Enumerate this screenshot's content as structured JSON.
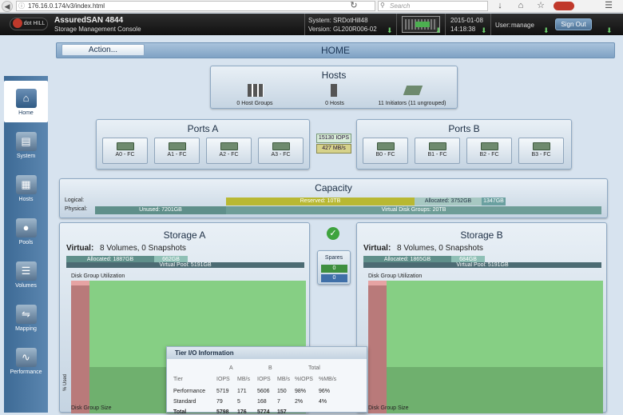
{
  "browser": {
    "url": "176.16.0.174/v3/index.html",
    "search_placeholder": "Search"
  },
  "header": {
    "product": "AssuredSAN 4844",
    "console": "Storage Management Console",
    "logo_text": "dot HILL",
    "system_label": "System:",
    "system_name": "SRDotHill48",
    "version_label": "Version:",
    "version": "GL200R006-02",
    "date": "2015-01-08",
    "time": "14:18:38",
    "user_label": "User:",
    "user": "manage",
    "sign_out": "Sign Out"
  },
  "sidebar": {
    "items": [
      {
        "label": "Home",
        "icon": "home-icon",
        "active": true
      },
      {
        "label": "System",
        "icon": "system-icon"
      },
      {
        "label": "Hosts",
        "icon": "hosts-icon"
      },
      {
        "label": "Pools",
        "icon": "pools-icon"
      },
      {
        "label": "Volumes",
        "icon": "volumes-icon"
      },
      {
        "label": "Mapping",
        "icon": "mapping-icon"
      },
      {
        "label": "Performance",
        "icon": "performance-icon"
      }
    ]
  },
  "toolbar": {
    "action_label": "Action...",
    "page_title": "HOME"
  },
  "hosts": {
    "title": "Hosts",
    "host_groups": "0 Host Groups",
    "hosts": "0 Hosts",
    "initiators": "11 Initiators (11 ungrouped)"
  },
  "ports_a": {
    "title": "Ports A",
    "ports": [
      "A0 - FC",
      "A1 - FC",
      "A2 - FC",
      "A3 - FC"
    ]
  },
  "ports_b": {
    "title": "Ports B",
    "ports": [
      "B0 - FC",
      "B1 - FC",
      "B2 - FC",
      "B3 - FC"
    ]
  },
  "throughput": {
    "iops": "15130 IOPS",
    "mbps": "427 MB/s"
  },
  "capacity": {
    "title": "Capacity",
    "logical_label": "Logical:",
    "physical_label": "Physical:",
    "reserved": "Reserved: 10TB",
    "allocated": "Allocated: 3752GB",
    "free": "1347GB",
    "unused": "Unused: 7201GB",
    "vdg": "Virtual Disk Groups: 20TB"
  },
  "storage_a": {
    "title": "Storage A",
    "virtual_label": "Virtual:",
    "volumes": "8 Volumes, 0 Snapshots",
    "allocated": "Allocated: 1887GB",
    "free": "662GB",
    "pool": "Virtual Pool: 5191GB",
    "dg_title": "Disk Group Utilization",
    "y_label": "% Used",
    "x_label": "Disk Group Size"
  },
  "storage_b": {
    "title": "Storage B",
    "virtual_label": "Virtual:",
    "volumes": "8 Volumes, 0 Snapshots",
    "allocated": "Allocated: 1865GB",
    "free": "684GB",
    "pool": "Virtual Pool: 5191GB",
    "dg_title": "Disk Group Utilization",
    "x_label": "Disk Group Size"
  },
  "spares": {
    "title": "Spares",
    "a": "0",
    "b": "0"
  },
  "tier_io": {
    "title": "Tier I/O Information",
    "group_headers": [
      "A",
      "B",
      "Total"
    ],
    "headers": [
      "Tier",
      "IOPS",
      "MB/s",
      "IOPS",
      "MB/s",
      "%IOPS",
      "%MB/s"
    ],
    "rows": [
      [
        "Performance",
        "5719",
        "171",
        "5606",
        "150",
        "98%",
        "96%"
      ],
      [
        "Standard",
        "79",
        "5",
        "168",
        "7",
        "2%",
        "4%"
      ],
      [
        "Total",
        "5798",
        "176",
        "5774",
        "157",
        "",
        ""
      ]
    ]
  },
  "colors": {
    "accent": "#4d7296",
    "reserved": "#b8b832",
    "allocated": "#5f8f8a",
    "utilization": "#86cf84",
    "used": "#b97a7a"
  }
}
